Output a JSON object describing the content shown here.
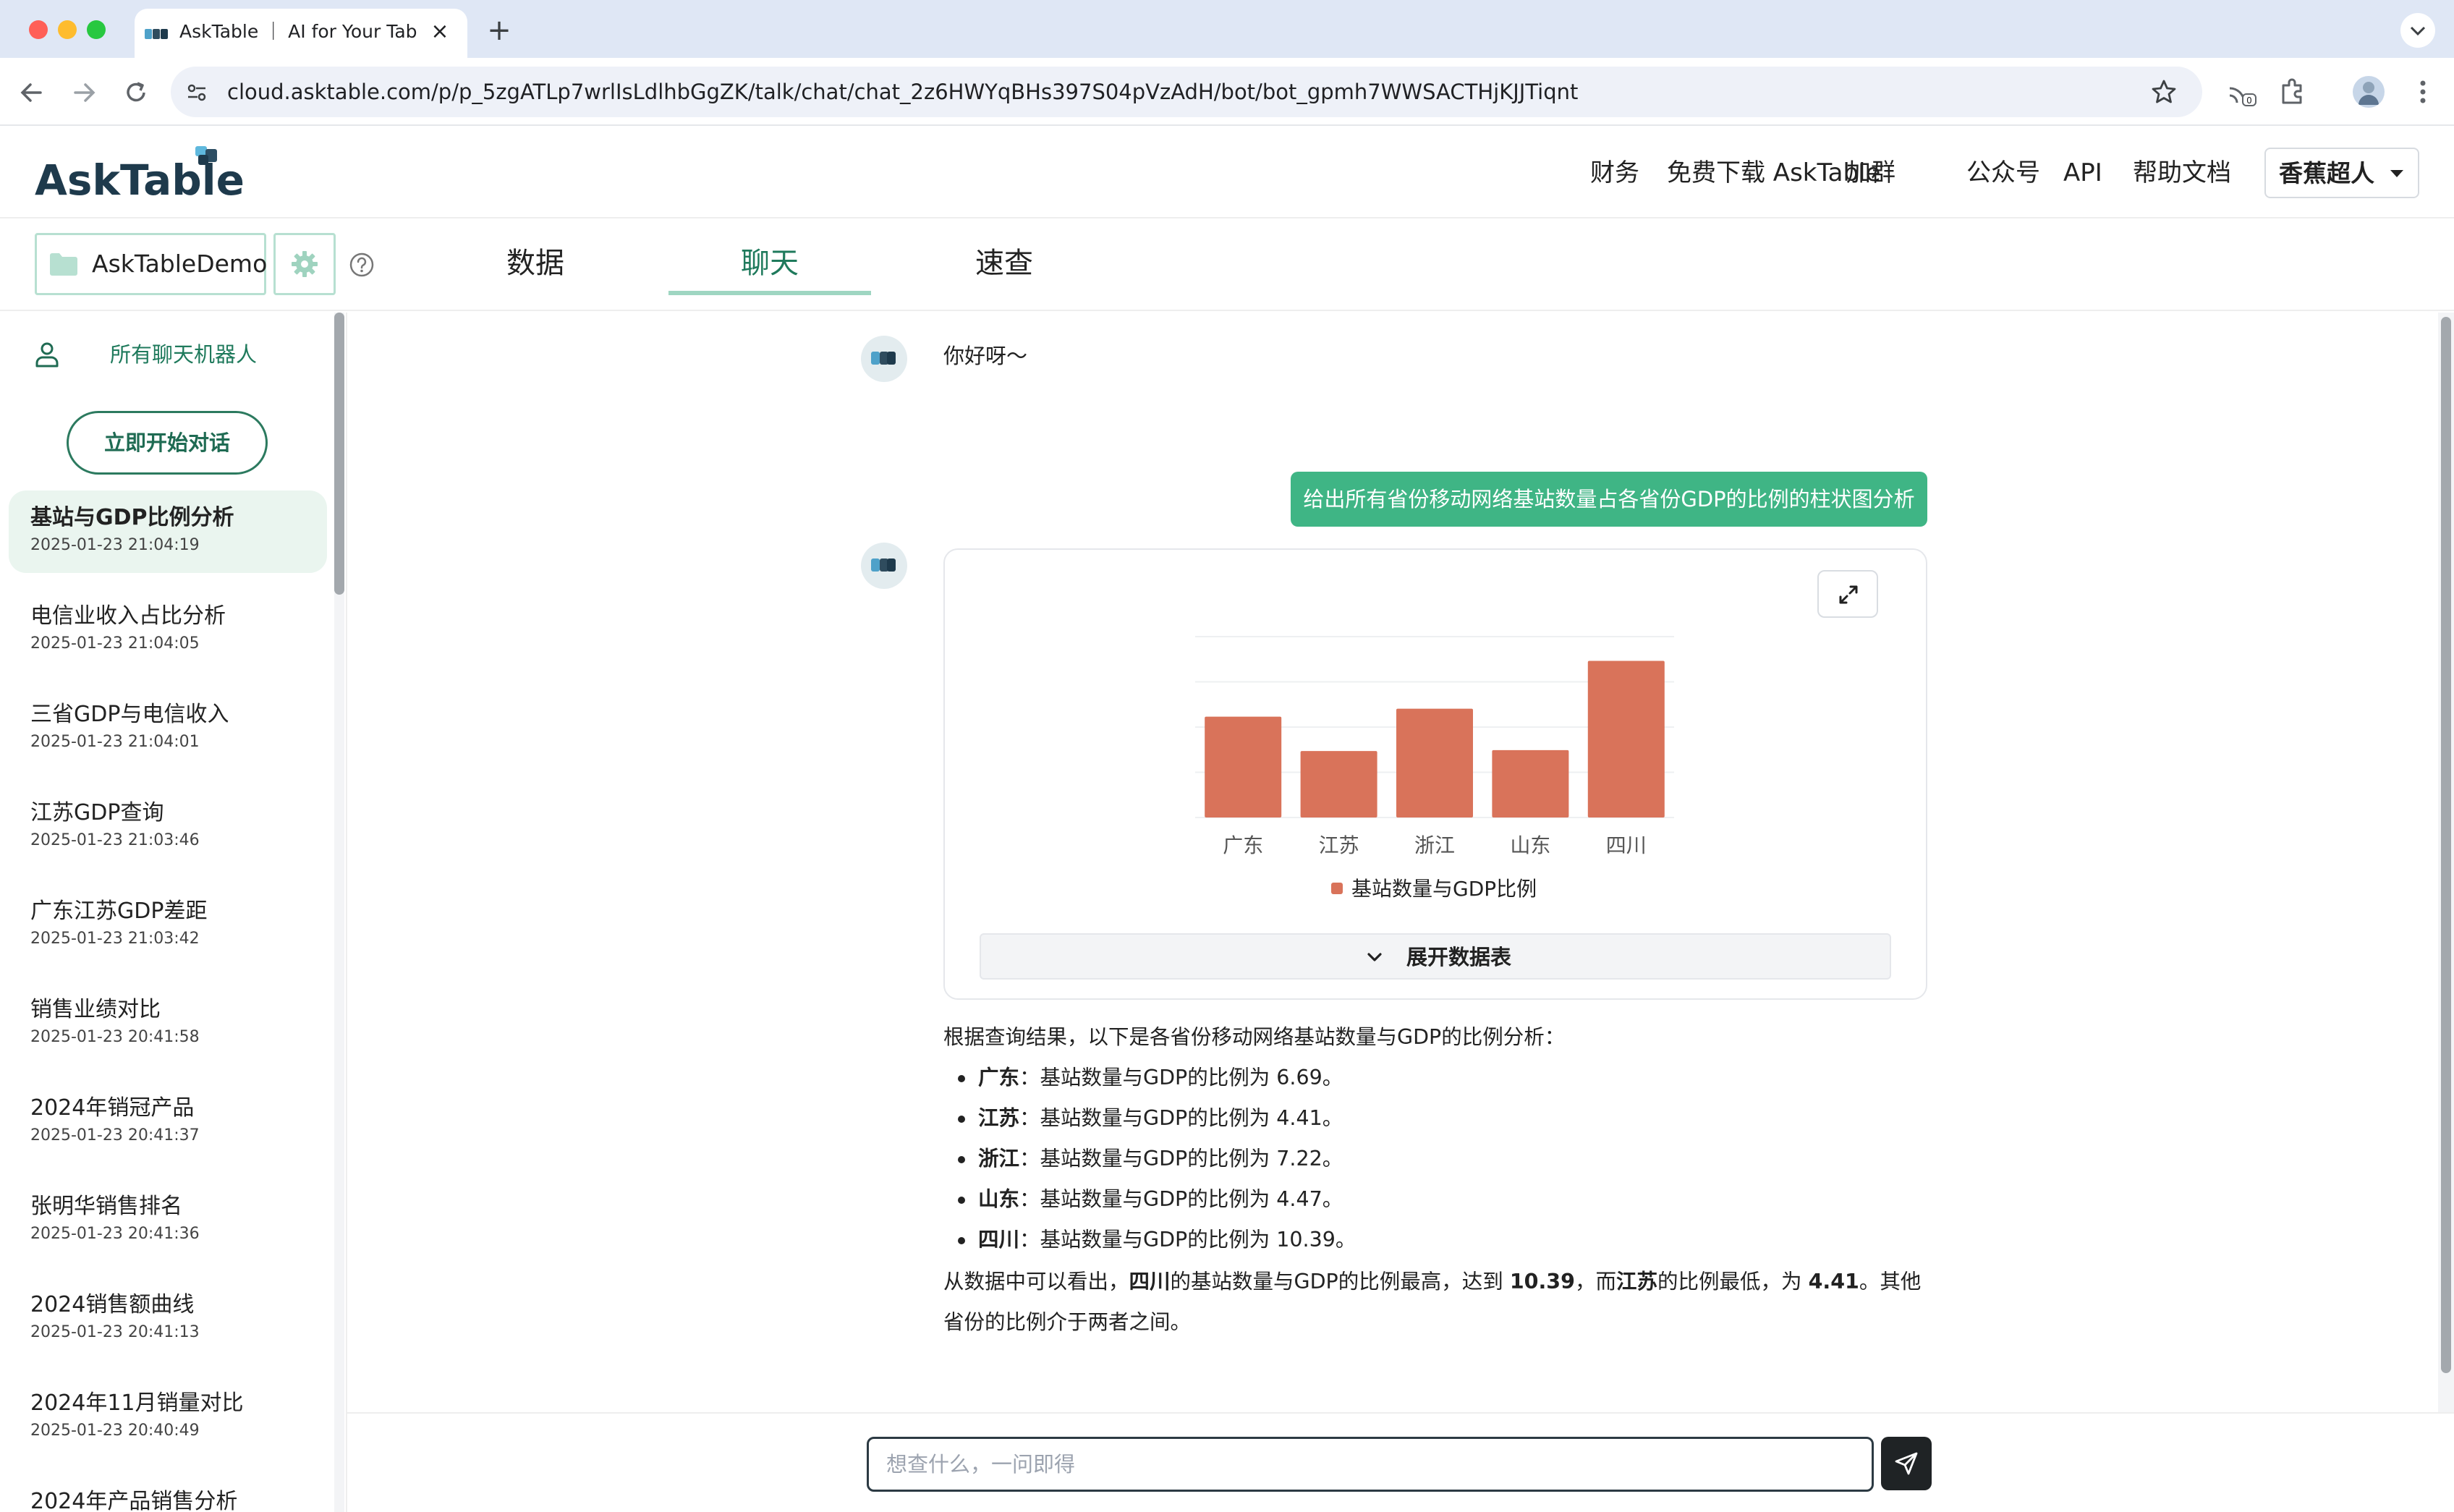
{
  "browser": {
    "tab_title": "AskTable ｜ AI for Your Tables",
    "url": "cloud.asktable.com/p/p_5zgATLp7wrlIsLdlhbGgZK/talk/chat/chat_2z6HWYqBHs397S04pVzAdH/bot/bot_gpmh7WWSACTHjKJJTiqnt",
    "extension_badge": "0"
  },
  "header": {
    "logo_text": "AskTable",
    "nav": {
      "finance": "财务",
      "download": "免费下载 AskTable",
      "join_group": "加群",
      "official_account": "公众号",
      "api": "API",
      "help_docs": "帮助文档"
    },
    "user_name": "香蕉超人"
  },
  "subheader": {
    "datasource_name": "AskTableDemo",
    "tabs": {
      "data": "数据",
      "chat": "聊天",
      "quick_query": "速查"
    },
    "active_tab": "聊天"
  },
  "sidebar": {
    "all_bots_label": "所有聊天机器人",
    "start_chat_label": "立即开始对话",
    "chats": [
      {
        "title": "基站与GDP比例分析",
        "time": "2025-01-23 21:04:19",
        "active": true
      },
      {
        "title": "电信业收入占比分析",
        "time": "2025-01-23 21:04:05"
      },
      {
        "title": "三省GDP与电信收入",
        "time": "2025-01-23 21:04:01"
      },
      {
        "title": "江苏GDP查询",
        "time": "2025-01-23 21:03:46"
      },
      {
        "title": "广东江苏GDP差距",
        "time": "2025-01-23 21:03:42"
      },
      {
        "title": "销售业绩对比",
        "time": "2025-01-23 20:41:58"
      },
      {
        "title": "2024年销冠产品",
        "time": "2025-01-23 20:41:37"
      },
      {
        "title": "张明华销售排名",
        "time": "2025-01-23 20:41:36"
      },
      {
        "title": "2024销售额曲线",
        "time": "2025-01-23 20:41:13"
      },
      {
        "title": "2024年11月销量对比",
        "time": "2025-01-23 20:40:49"
      },
      {
        "title": "2024年产品销售分析",
        "time": ""
      }
    ]
  },
  "chat": {
    "greeting": "你好呀～",
    "user_message": "给出所有省份移动网络基站数量占各省份GDP的比例的柱状图分析",
    "table_toggle_label": "展开数据表",
    "analysis": {
      "intro": "根据查询结果，以下是各省份移动网络基站数量与GDP的比例分析：",
      "items": [
        {
          "province": "广东",
          "text": "：基站数量与GDP的比例为 6.69。"
        },
        {
          "province": "江苏",
          "text": "：基站数量与GDP的比例为 4.41。"
        },
        {
          "province": "浙江",
          "text": "：基站数量与GDP的比例为 7.22。"
        },
        {
          "province": "山东",
          "text": "：基站数量与GDP的比例为 4.47。"
        },
        {
          "province": "四川",
          "text": "：基站数量与GDP的比例为 10.39。"
        }
      ],
      "conclusion_1": "从数据中可以看出，",
      "conclusion_2": "四川",
      "conclusion_3": "的基站数量与GDP的比例最高，达到 ",
      "conclusion_4": "10.39",
      "conclusion_5": "，而",
      "conclusion_6": "江苏",
      "conclusion_7": "的比例最低，为 ",
      "conclusion_8": "4.41",
      "conclusion_9": "。其他省份的比例介于两者之间。"
    },
    "input_placeholder": "想查什么，一问即得"
  },
  "colors": {
    "brand_green": "#3fb585",
    "bar_color": "#d9735a",
    "active_chat_bg": "#eaf5ef"
  },
  "chart_data": {
    "type": "bar",
    "categories": [
      "广东",
      "江苏",
      "浙江",
      "山东",
      "四川"
    ],
    "series": [
      {
        "name": "基站数量与GDP比例",
        "values": [
          6.69,
          4.41,
          7.22,
          4.47,
          10.39
        ]
      }
    ],
    "ylim": [
      0,
      12
    ],
    "grid": true,
    "legend": "bottom"
  }
}
